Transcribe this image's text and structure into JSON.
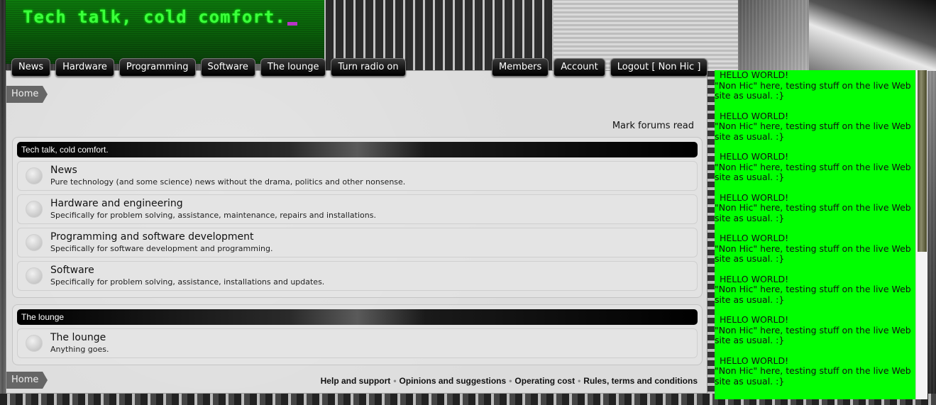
{
  "site": {
    "title": "Tech talk, cold comfort."
  },
  "nav": {
    "left": [
      "News",
      "Hardware",
      "Programming",
      "Software",
      "The lounge",
      "Turn radio on"
    ],
    "right": [
      "Members",
      "Account",
      "Logout [ Non Hic ]"
    ]
  },
  "breadcrumb": {
    "home": "Home"
  },
  "actions": {
    "mark_read": "Mark forums read"
  },
  "categories": [
    {
      "title": "Tech talk, cold comfort.",
      "forums": [
        {
          "title": "News",
          "desc": "Pure technology (and some science) news without the drama, politics and other nonsense."
        },
        {
          "title": "Hardware and engineering",
          "desc": "Specifically for problem solving, assistance, maintenance, repairs and installations."
        },
        {
          "title": "Programming and software development",
          "desc": "Specifically for software development and programming."
        },
        {
          "title": "Software",
          "desc": "Specifically for problem solving, assistance, installations and updates."
        }
      ]
    },
    {
      "title": "The lounge",
      "forums": [
        {
          "title": "The lounge",
          "desc": "Anything goes."
        }
      ]
    }
  ],
  "footer": {
    "links": [
      "Help and support",
      "Opinions and suggestions",
      "Operating cost",
      "Rules, terms and conditions"
    ]
  },
  "side": {
    "messages": [
      {
        "head": "HELLO WORLD!",
        "body": "\"Non Hic\" here, testing stuff on the live Web site as usual. :}"
      },
      {
        "head": "HELLO WORLD!",
        "body": "\"Non Hic\" here, testing stuff on the live Web site as usual. :}"
      },
      {
        "head": "HELLO WORLD!",
        "body": "\"Non Hic\" here, testing stuff on the live Web site as usual. :}"
      },
      {
        "head": "HELLO WORLD!",
        "body": "\"Non Hic\" here, testing stuff on the live Web site as usual. :}"
      },
      {
        "head": "HELLO WORLD!",
        "body": "\"Non Hic\" here, testing stuff on the live Web site as usual. :}"
      },
      {
        "head": "HELLO WORLD!",
        "body": "\"Non Hic\" here, testing stuff on the live Web site as usual. :}"
      },
      {
        "head": "HELLO WORLD!",
        "body": "\"Non Hic\" here, testing stuff on the live Web site as usual. :}"
      },
      {
        "head": "HELLO WORLD!",
        "body": "\"Non Hic\" here, testing stuff on the live Web site as usual. :}"
      }
    ]
  },
  "colors": {
    "banner": "#0a5d0a",
    "title_text": "#3cff3c",
    "cursor": "#b833c7",
    "side_bg": "#00ff00"
  }
}
